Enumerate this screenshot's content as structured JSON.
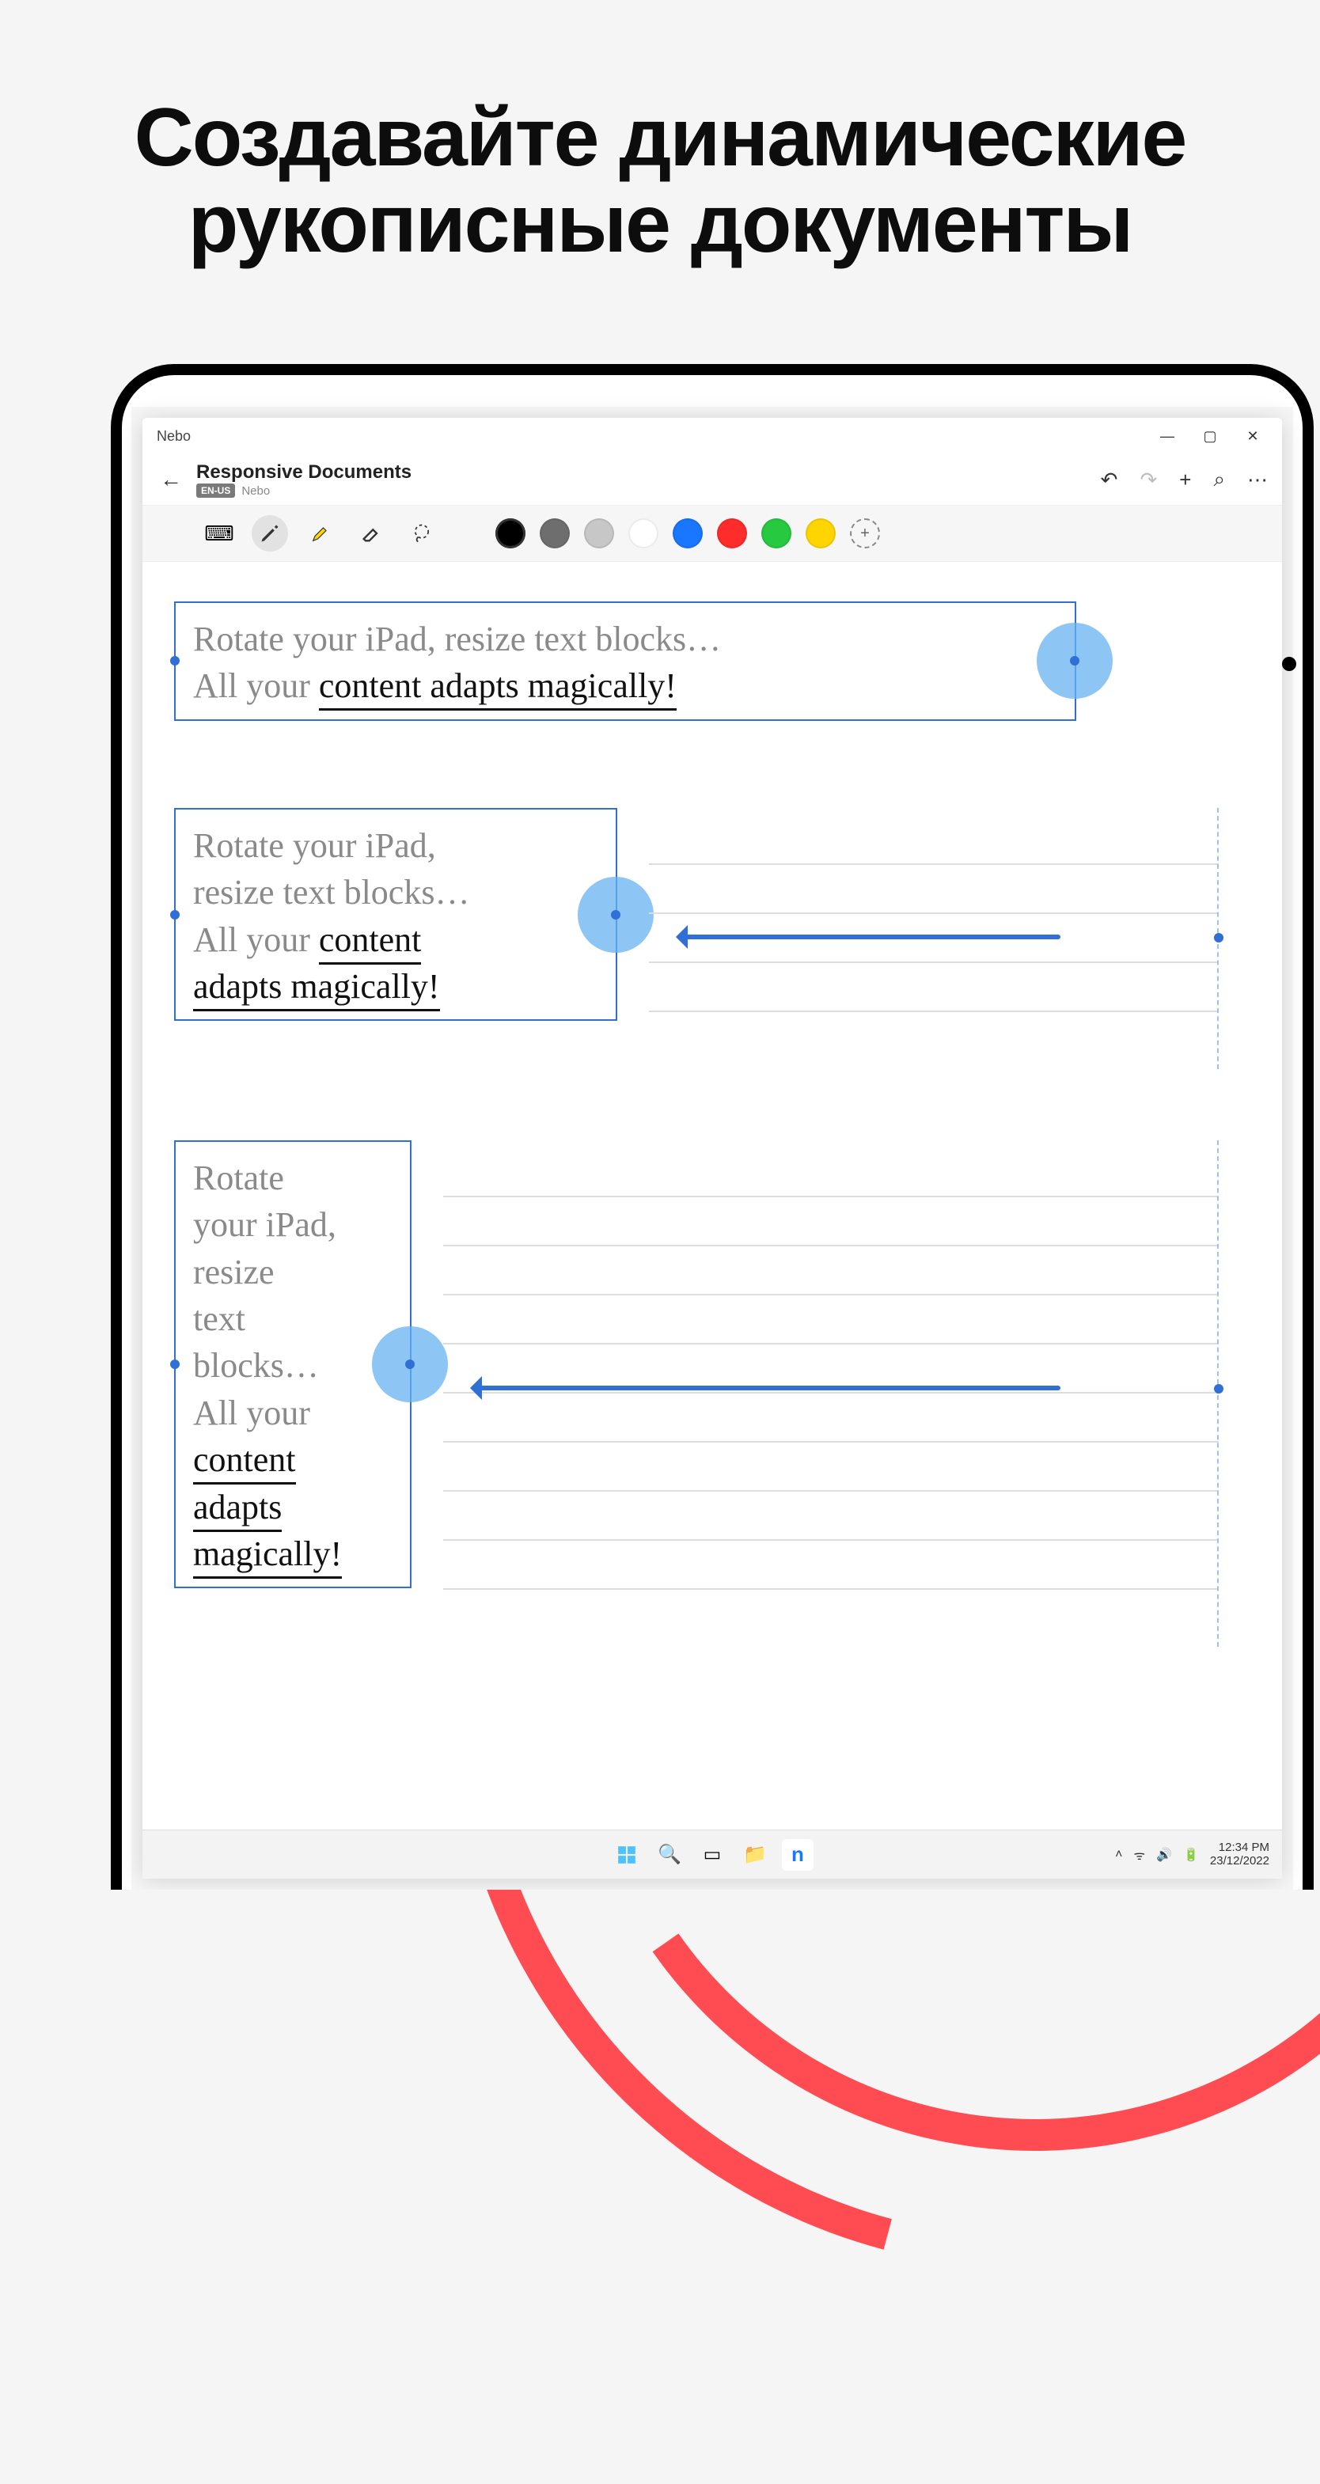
{
  "headline": "Создавайте динамические рукописные документы",
  "window": {
    "app_title": "Nebo",
    "controls": {
      "min": "—",
      "max": "▢",
      "close": "✕"
    }
  },
  "header": {
    "back": "←",
    "doc_title": "Responsive Documents",
    "lang_badge": "EN-US",
    "breadcrumb": "Nebo",
    "undo": "↶",
    "redo": "↷",
    "add": "+",
    "search": "⌕",
    "more": "⋯"
  },
  "toolbar": {
    "keyboard": "⌨",
    "pen": "pen",
    "highlighter": "highlighter",
    "eraser": "eraser",
    "lasso": "lasso",
    "add_color": "+"
  },
  "colors": [
    "#000000",
    "#6e6e6e",
    "#c7c7c7",
    "#ffffff",
    "#1976ff",
    "#ff2c2c",
    "#26c940",
    "#ffd500"
  ],
  "blocks": {
    "b1": {
      "l1": "Rotate your iPad, resize text blocks…",
      "l2_a": "All your ",
      "l2_b": "content adapts magically!"
    },
    "b2": {
      "l1": "Rotate your iPad,",
      "l2": "resize text blocks…",
      "l3_a": "All your ",
      "l3_b": "content",
      "l4": "adapts magically!"
    },
    "b3": {
      "l1": "Rotate",
      "l2": "your iPad,",
      "l3": "resize",
      "l4": "text",
      "l5": "blocks…",
      "l6": "All your",
      "l7": "content",
      "l8": "adapts",
      "l9": "magically!"
    }
  },
  "taskbar": {
    "time": "12:34 PM",
    "date": "23/12/2022",
    "wifi": "ᯤ",
    "vol": "🔊",
    "bat": "🔋",
    "chevron": "˄"
  }
}
